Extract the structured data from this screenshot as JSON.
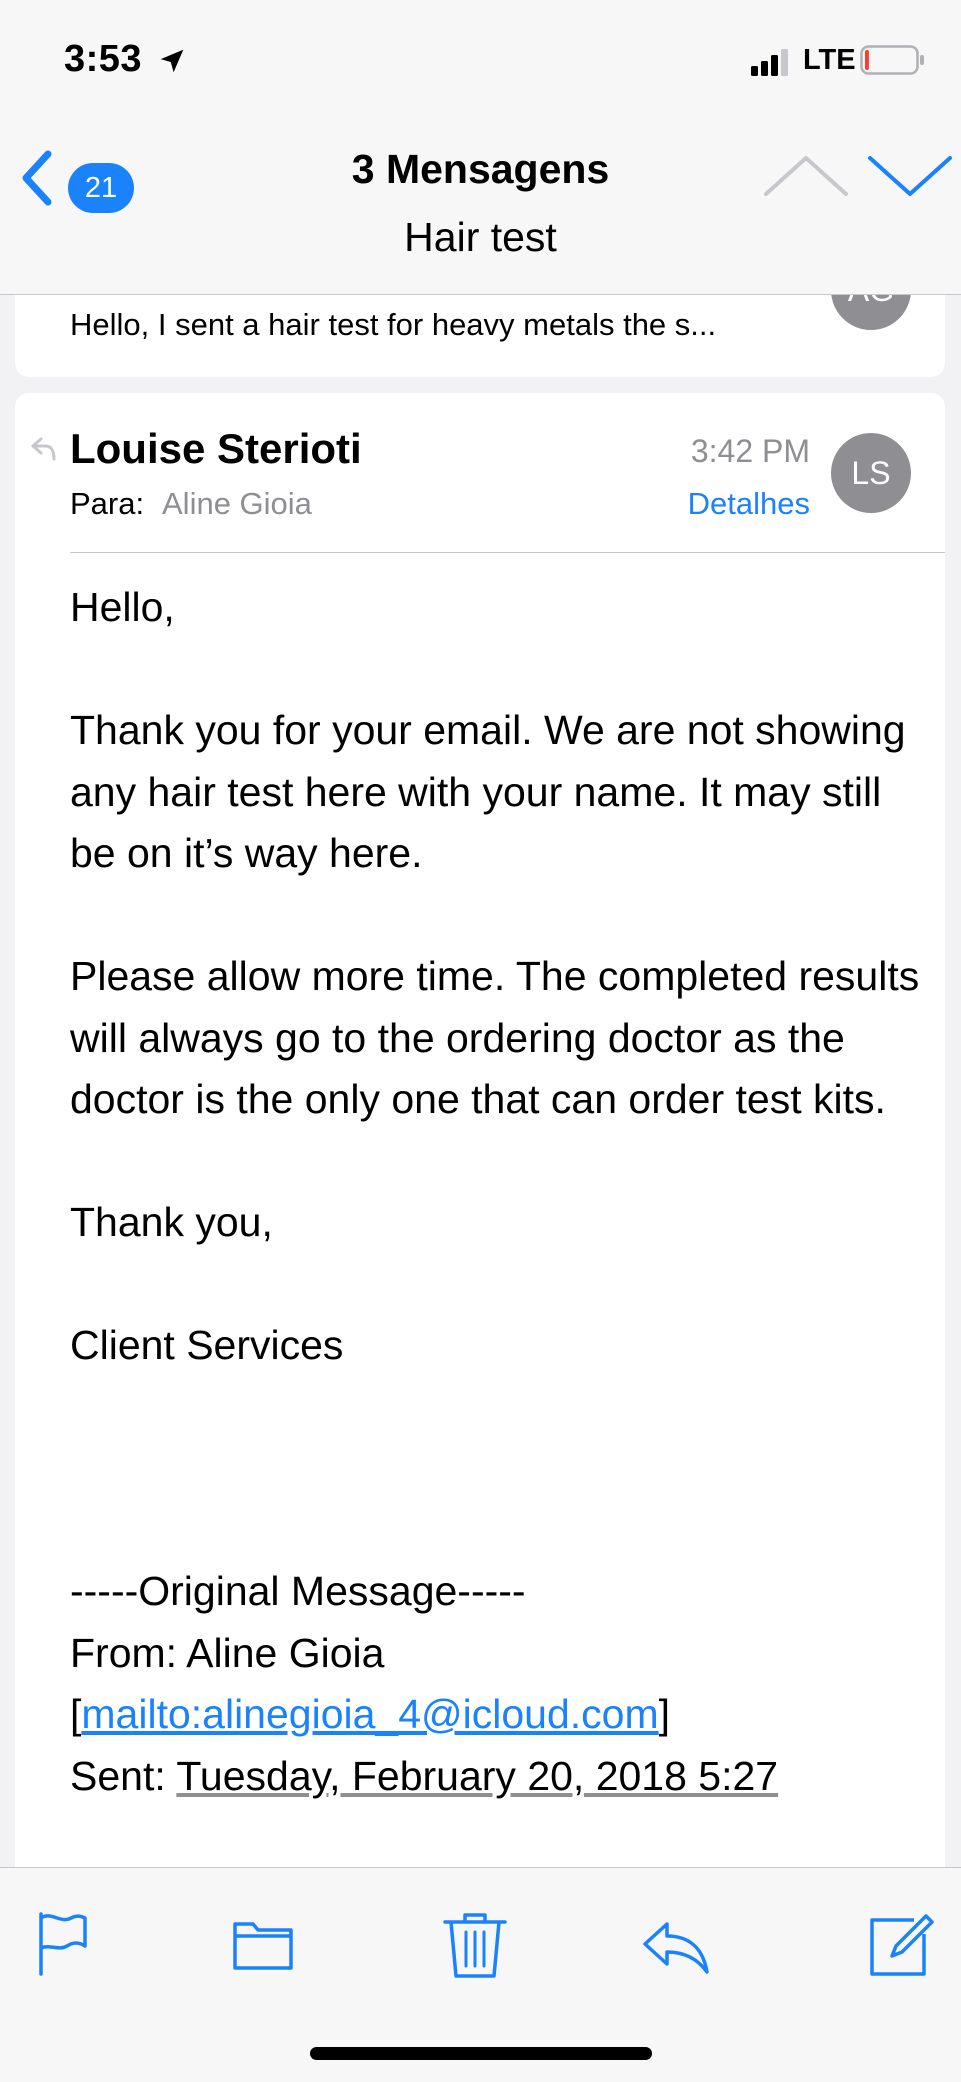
{
  "status_bar": {
    "time": "3:53",
    "network": "LTE",
    "battery_level": 0.08,
    "icons": [
      "location-arrow-icon",
      "signal-bars-icon",
      "battery-icon"
    ]
  },
  "nav": {
    "back_count": "21",
    "title": "3 Mensagens",
    "subtitle": "Hair test",
    "icons": [
      "chevron-left-icon",
      "chevron-up-icon",
      "chevron-down-icon"
    ]
  },
  "previous_message": {
    "snippet": "Hello, I sent a hair test for heavy metals the s...",
    "avatar_initials": "AG"
  },
  "message": {
    "sender": "Louise Sterioti",
    "to_label": "Para:",
    "to_name": "Aline Gioia",
    "time": "3:42 PM",
    "details_label": "Detalhes",
    "avatar_initials": "LS",
    "body": {
      "greeting": "Hello,",
      "para1": "Thank you for your email.  We are not showing any hair test here with your name.  It may still be on it’s way here.",
      "para2": "Please allow more time.  The completed results will always go to the ordering doctor as the doctor is the only one that can order test kits.",
      "signoff": "Thank you,",
      "signature": "Client Services",
      "original_header": "-----Original Message-----",
      "from_line": "From: Aline Gioia",
      "mailto_open": "[",
      "mailto_link": "mailto:alinegioia_4@icloud.com",
      "mailto_close": "]",
      "sent_label": "Sent: ",
      "sent_value": "Tuesday, February 20, 2018 5:27"
    }
  },
  "toolbar": {
    "icons": [
      "flag-icon",
      "folder-icon",
      "trash-icon",
      "reply-icon",
      "compose-icon"
    ]
  },
  "colors": {
    "accent": "#1a82fb",
    "secondary_text": "#8e8e93",
    "avatar": "#8e8e93"
  }
}
